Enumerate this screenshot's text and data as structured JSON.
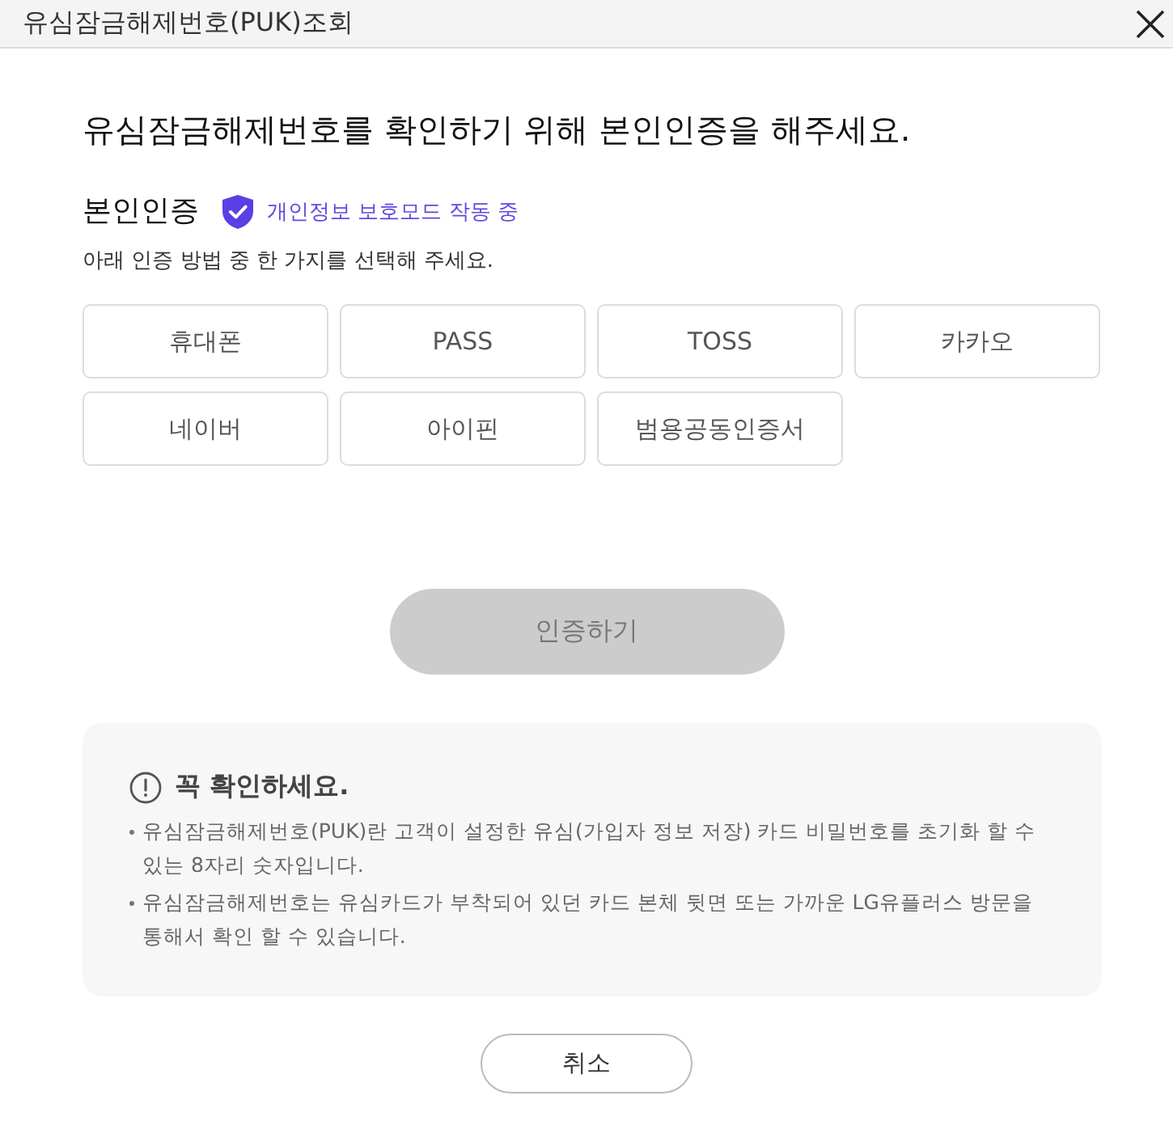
{
  "dialog": {
    "title": "유심잠금해제번호(PUK)조회"
  },
  "heading": "유심잠금해제번호를 확인하기 위해 본인인증을 해주세요.",
  "auth": {
    "title": "본인인증",
    "privacy_badge": "개인정보 보호모드 작동 중",
    "instruction": "아래 인증 방법 중 한 가지를 선택해 주세요.",
    "methods": [
      {
        "label": "휴대폰",
        "selected": false
      },
      {
        "label": "PASS",
        "selected": false
      },
      {
        "label": "TOSS",
        "selected": false
      },
      {
        "label": "카카오",
        "selected": false
      },
      {
        "label": "네이버",
        "selected": false
      },
      {
        "label": "아이핀",
        "selected": false
      },
      {
        "label": "범용공동인증서",
        "selected": false
      }
    ]
  },
  "submit_button": {
    "label": "인증하기",
    "disabled": true
  },
  "notice": {
    "title": "꼭 확인하세요.",
    "items": [
      "유심잠금해제번호(PUK)란 고객이 설정한 유심(가입자 정보 저장) 카드 비밀번호를 초기화 할 수 있는 8자리 숫자입니다.",
      "유심잠금해제번호는 유심카드가 부착되어 있던 카드 본체 뒷면 또는 가까운 LG유플러스 방문을 통해서 확인 할 수 있습니다."
    ]
  },
  "cancel_button": {
    "label": "취소"
  }
}
